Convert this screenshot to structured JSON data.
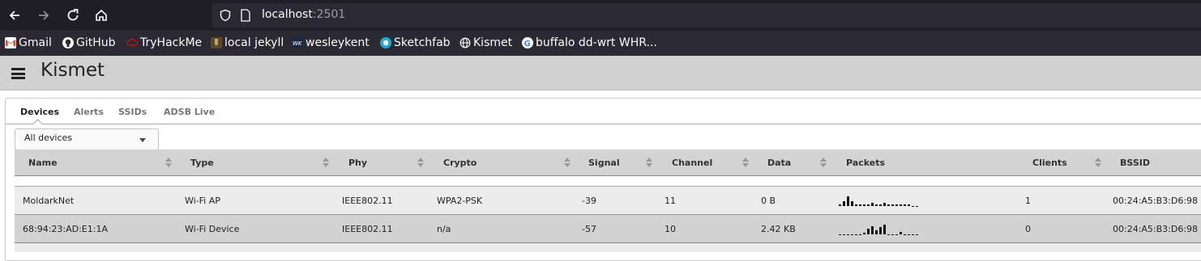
{
  "browser": {
    "url_host": "localhost",
    "url_port": ":2501",
    "bookmarks": [
      "Gmail",
      "GitHub",
      "TryHackMe",
      "local jekyll",
      "wesleykent",
      "Sketchfab",
      "Kismet",
      "buffalo dd-wrt WHR..."
    ]
  },
  "app": {
    "title": "Kismet"
  },
  "tabs": [
    "Devices",
    "Alerts",
    "SSIDs",
    "ADSB Live"
  ],
  "filter": {
    "selected": "All devices"
  },
  "table": {
    "columns": [
      "Name",
      "Type",
      "Phy",
      "Crypto",
      "Signal",
      "Channel",
      "Data",
      "Packets",
      "Clients",
      "BSSID"
    ],
    "rows": [
      {
        "name": "MoldarkNet",
        "type": "Wi-Fi AP",
        "phy": "IEEE802.11",
        "crypto": "WPA2-PSK",
        "signal": "-39",
        "channel": "11",
        "data": "0 B",
        "packets": [
          1,
          3,
          6,
          3,
          1,
          1,
          1,
          1,
          2,
          1,
          1,
          2,
          1,
          1,
          1,
          1,
          1,
          1,
          0,
          0
        ],
        "clients": "1",
        "bssid": "00:24:A5:B3:D6:98"
      },
      {
        "name": "68:94:23:AD:E1:1A",
        "type": "Wi-Fi Device",
        "phy": "IEEE802.11",
        "crypto": "n/a",
        "signal": "-57",
        "channel": "10",
        "data": "2.42 KB",
        "packets": [
          0,
          0,
          0,
          0,
          0,
          0,
          1,
          4,
          6,
          3,
          5,
          7,
          0,
          0,
          0,
          2,
          0,
          0,
          0,
          0
        ],
        "clients": "0",
        "bssid": "00:24:A5:B3:D6:98"
      }
    ]
  },
  "colors": {
    "browser_bg": "#1f1e25",
    "header_bg": "#d1d1d1",
    "row_alt": "#d2d2d2"
  }
}
